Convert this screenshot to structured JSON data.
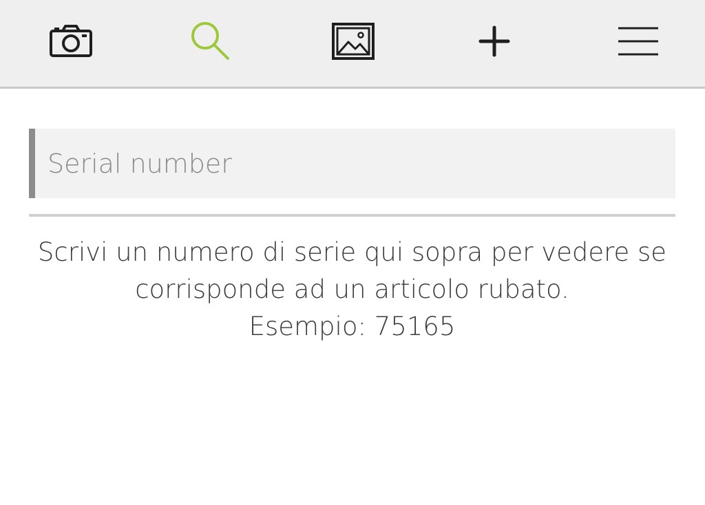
{
  "nav": {
    "items": [
      {
        "icon": "camera-icon"
      },
      {
        "icon": "search-icon",
        "active": true,
        "color": "#9dc83a"
      },
      {
        "icon": "image-icon"
      },
      {
        "icon": "plus-icon"
      },
      {
        "icon": "menu-icon"
      }
    ]
  },
  "search": {
    "placeholder": "Serial number",
    "value": ""
  },
  "help": {
    "line1": "Scrivi un numero di serie qui sopra per vedere se",
    "line2": "corrisponde ad un articolo rubato.",
    "line3": "Esempio: 75165"
  },
  "colors": {
    "topbar": "#efefef",
    "accent": "#9dc83a",
    "icon": "#1f1f1f"
  }
}
